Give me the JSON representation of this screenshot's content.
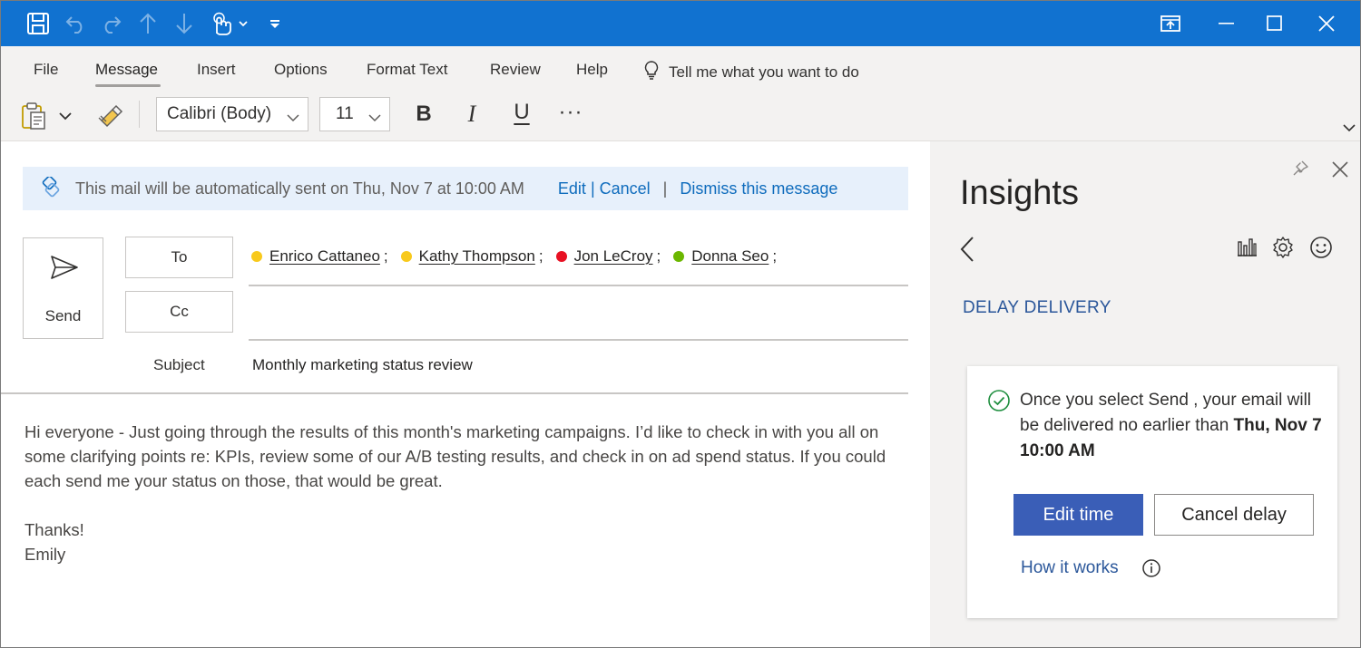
{
  "titlebar": {
    "icons": [
      "save-icon",
      "undo-icon",
      "redo-icon",
      "up-arrow-icon",
      "down-arrow-icon",
      "touch-mode-icon",
      "customize-toolbar-icon",
      "restore-window-icon",
      "minimize-icon",
      "maximize-icon",
      "close-icon"
    ],
    "colors": {
      "background": "#1172d0"
    }
  },
  "ribbon": {
    "tabs": [
      {
        "label": "File"
      },
      {
        "label": "Message",
        "active": true
      },
      {
        "label": "Insert"
      },
      {
        "label": "Options"
      },
      {
        "label": "Format Text"
      },
      {
        "label": "Review"
      },
      {
        "label": "Help"
      }
    ],
    "tell_me": "Tell me what you want to do",
    "font_name": "Calibri (Body)",
    "font_size": "11",
    "bold": "B",
    "italic": "I",
    "underline": "U",
    "more": "···"
  },
  "infobar": {
    "message": "This mail will be automatically sent on Thu, Nov 7 at 10:00 AM",
    "edit": "Edit",
    "separator": "|",
    "cancel": "Cancel",
    "dismiss": "Dismiss this message"
  },
  "compose": {
    "send_label": "Send",
    "to_label": "To",
    "cc_label": "Cc",
    "recipients": [
      {
        "name": "Enrico Cattaneo",
        "sep": ";",
        "status": "away",
        "color": "#f8c91c"
      },
      {
        "name": "Kathy Thompson",
        "sep": ";",
        "status": "away",
        "color": "#f8c91c"
      },
      {
        "name": "Jon LeCroy",
        "sep": ";",
        "status": "busy",
        "color": "#e81123"
      },
      {
        "name": "Donna Seo",
        "sep": ";",
        "status": "available",
        "color": "#6bb700"
      }
    ],
    "subject_label": "Subject",
    "subject": "Monthly marketing status review",
    "body": [
      "Hi everyone - Just going through the results of this month's marketing campaigns. I’d like to check in with you all on some clarifying points re: KPIs, review some of our A/B testing results, and check in on ad spend status. If you could each send me your status on those, that would be great.",
      "Thanks!",
      "Emily"
    ]
  },
  "insights": {
    "title": "Insights",
    "section": "DELAY DELIVERY",
    "card_text_prefix": "Once you select Send , your email will be delivered no earlier than ",
    "card_text_bold": "Thu, Nov 7 10:00 AM",
    "edit_time": "Edit time",
    "cancel_delay": "Cancel delay",
    "how_it_works": "How it works",
    "colors": {
      "accent": "#2b579a",
      "primary_button": "#3a5eb7"
    }
  }
}
